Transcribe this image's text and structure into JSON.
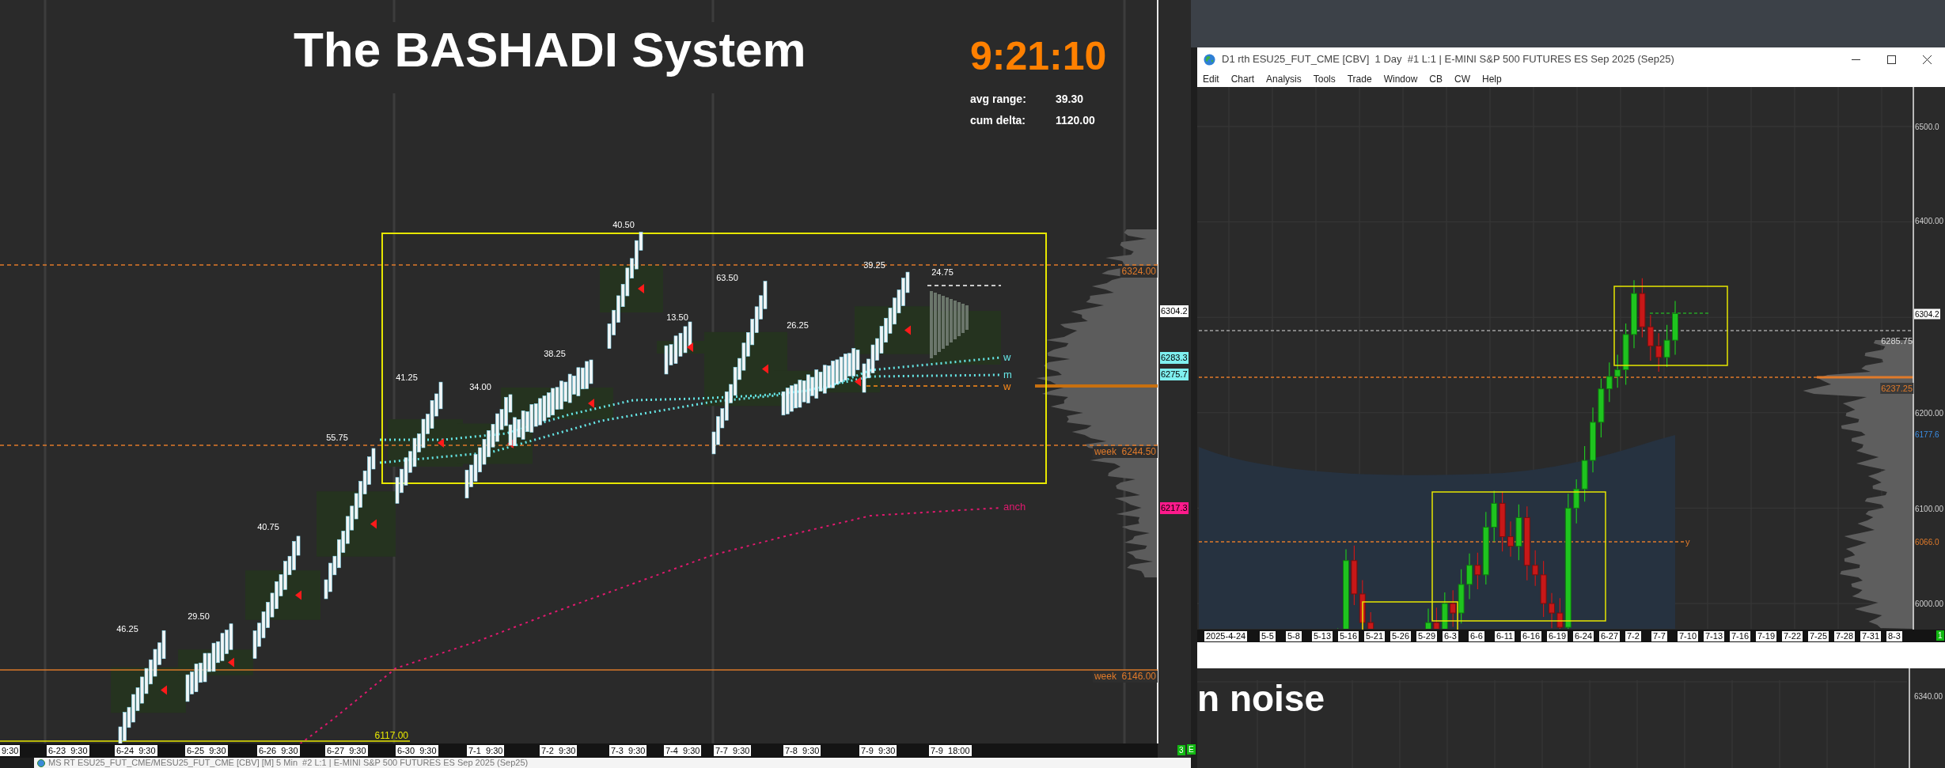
{
  "left_window": {
    "title": "The BASHADI System",
    "clock": "9:21:10",
    "stats": [
      {
        "label": "avg range:",
        "value": "39.30"
      },
      {
        "label": "cum delta:",
        "value": "1120.00"
      }
    ],
    "range_labels": [
      "46.25",
      "29.50",
      "40.75",
      "55.75",
      "41.25",
      "34.00",
      "38.25",
      "40.50",
      "13.50",
      "63.50",
      "26.25",
      "39.25",
      "24.75"
    ],
    "line_tags": [
      {
        "text": "w",
        "color": "#66e6e6"
      },
      {
        "text": "m",
        "color": "#66e6e6"
      },
      {
        "text": "w",
        "color": "#ff8c1a"
      },
      {
        "text": "anch",
        "color": "#e0196e"
      }
    ],
    "level_labels": [
      {
        "text": "6324.00",
        "kind": "session"
      },
      {
        "text": "week  6244.50",
        "kind": "session"
      },
      {
        "text": "week  6146.00",
        "kind": "session"
      },
      {
        "text": "6117.00",
        "kind": "low"
      }
    ],
    "price_tags": [
      {
        "text": "6304.2",
        "kind": "last"
      },
      {
        "text": "6283.3",
        "kind": "vwap"
      },
      {
        "text": "6275.7",
        "kind": "vwap"
      },
      {
        "text": "6217.3",
        "kind": "anchor"
      }
    ],
    "time_axis": [
      "9:30",
      "6-23  9:30",
      "6-24  9:30",
      "6-25  9:30",
      "6-26  9:30",
      "6-27  9:30",
      "6-30  9:30",
      "7-1  9:30",
      "7-2  9:30",
      "7-3  9:30",
      "7-4  9:30",
      "7-7  9:30",
      "7-8  9:30",
      "7-9  9:30",
      "7-9  18:00"
    ],
    "badge": "3",
    "footer_title": "MS RT ESU25_FUT_CME/MESU25_FUT_CME [CBV] [M] 5 Min  #2 L:1 | E-MINI S&P 500 FUTURES ES Sep 2025 (Sep25)"
  },
  "right_window": {
    "title": "D1 rth ESU25_FUT_CME [CBV]  1 Day  #1 L:1 | E-MINI S&P 500 FUTURES ES Sep 2025 (Sep25)",
    "menu": [
      "Edit",
      "Chart",
      "Analysis",
      "Tools",
      "Trade",
      "Window",
      "CB",
      "CW",
      "Help"
    ],
    "price_axis": [
      {
        "text": "6500.0",
        "kind": "tick"
      },
      {
        "text": "6400.00",
        "kind": "tick"
      },
      {
        "text": "6304.2",
        "kind": "last"
      },
      {
        "text": "6200.00",
        "kind": "tick"
      },
      {
        "text": "6177.6",
        "kind": "average"
      },
      {
        "text": "6100.00",
        "kind": "tick"
      },
      {
        "text": "6066.0",
        "kind": "level"
      },
      {
        "text": "6000.00",
        "kind": "tick"
      }
    ],
    "level_labels": [
      {
        "text": "6285.75",
        "kind": "close"
      },
      {
        "text": "6237.25",
        "kind": "poc"
      },
      {
        "text": "y",
        "kind": "tag"
      }
    ],
    "time_axis": [
      "2025-4-24",
      "5-5",
      "5-8",
      "5-13",
      "5-16",
      "5-21",
      "5-26",
      "5-29",
      "6-3",
      "6-6",
      "6-11",
      "6-16",
      "6-19",
      "6-24",
      "6-27",
      "7-2",
      "7-7",
      "7-10",
      "7-13",
      "7-16",
      "7-19",
      "7-22",
      "7-25",
      "7-28",
      "7-31",
      "8-3"
    ],
    "badge": "1"
  },
  "back_window": {
    "heading": "n noise",
    "price": "6340.00",
    "badge": "E"
  }
}
